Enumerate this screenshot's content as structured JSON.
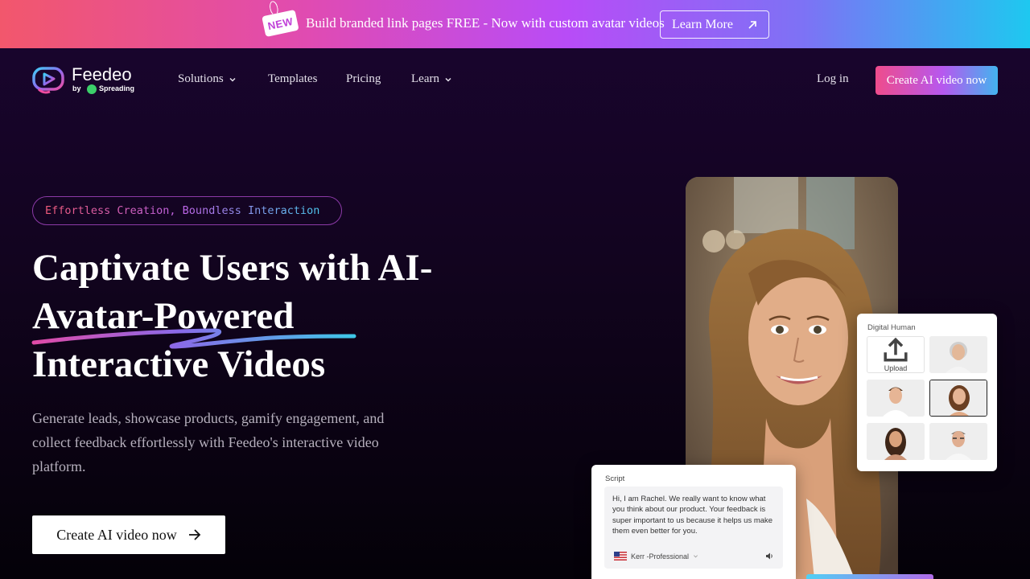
{
  "banner": {
    "tag": "NEW",
    "text": "Build branded link pages FREE - Now with custom avatar videos",
    "button_label": "Learn More"
  },
  "brand": {
    "name": "Feedeo",
    "by": "by",
    "parent": "Spreading"
  },
  "nav": {
    "items": [
      {
        "label": "Solutions",
        "has_dropdown": true
      },
      {
        "label": "Templates",
        "has_dropdown": false
      },
      {
        "label": "Pricing",
        "has_dropdown": false
      },
      {
        "label": "Learn",
        "has_dropdown": true
      }
    ],
    "login": "Log in",
    "cta": "Create AI video now"
  },
  "hero": {
    "pill": "Effortless Creation, Boundless Interaction",
    "headline_lines": [
      "Captivate Users with AI-",
      "Avatar-Powered",
      "Interactive Videos"
    ],
    "subtext": "Generate leads, showcase products, gamify engagement, and collect feedback effortlessly with Feedeo's interactive video platform.",
    "cta": "Create AI video now"
  },
  "digital_human": {
    "title": "Digital Human",
    "upload_label": "Upload"
  },
  "script": {
    "label": "Script",
    "text": "Hi, I am Rachel. We really want to know what you think about our product. Your feedback is super important to us because it helps us make them even better for you.",
    "voice": "Kerr -Professional"
  },
  "colors": {
    "accent_pink": "#ef4c8c",
    "accent_purple": "#b658ef",
    "accent_cyan": "#43b4ef",
    "background": "#12041f"
  }
}
